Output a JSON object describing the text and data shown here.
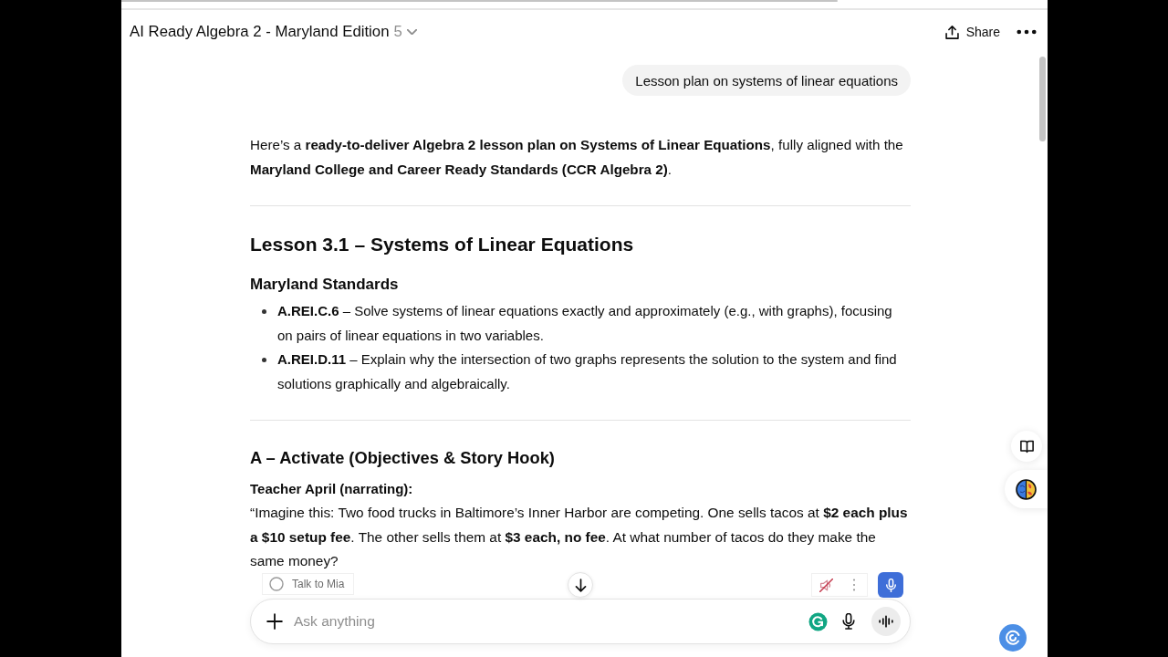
{
  "header": {
    "title": "AI Ready Algebra 2 - Maryland Edition",
    "count": "5",
    "share_label": "Share"
  },
  "user_message": "Lesson plan on systems of linear equations",
  "response": {
    "intro": "Here’s a **ready-to-deliver Algebra 2 lesson plan on Systems of Linear Equations**, fully aligned with the **Maryland College and Career Ready Standards (CCR Algebra 2)**.",
    "blocks": [
      {
        "kind": "rule"
      },
      {
        "kind": "title",
        "text": "Lesson 3.1 – Systems of Linear Equations"
      },
      {
        "kind": "subtitle",
        "text": "Maryland Standards"
      },
      {
        "kind": "bullets",
        "items": [
          "**A.REI.C.6** – Solve systems of linear equations exactly and approximately (e.g., with graphs), focusing on pairs of linear equations in two variables.",
          "**A.REI.D.11** – Explain why the intersection of two graphs represents the solution to the system and find solutions graphically and algebraically."
        ]
      },
      {
        "kind": "rule"
      },
      {
        "kind": "section",
        "text": "A – Activate (Objectives & Story Hook)"
      },
      {
        "kind": "label",
        "text": "Teacher April (narrating):"
      },
      {
        "kind": "paragraph",
        "text": "“Imagine this: Two food trucks in Baltimore’s Inner Harbor are competing. One sells tacos at **$2 each plus a $10 setup fee**. The other sells them at **$3 each, no fee**. At what number of tacos do they make the same money?"
      }
    ]
  },
  "voice_chip": {
    "label": "Talk to Mia"
  },
  "voice_controls": {
    "muted": true
  },
  "composer": {
    "placeholder": "Ask anything"
  }
}
